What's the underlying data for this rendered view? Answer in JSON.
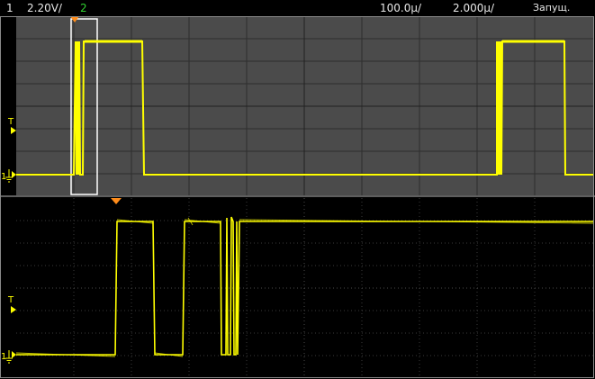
{
  "status_bar": {
    "ch1_number": "1",
    "ch1_scale": "2.20V/",
    "ch2_number": "2",
    "time_scale": "100.0µ/",
    "time_delay": "2.000µ/",
    "run_state": "Запущ."
  },
  "markers": {
    "trigger_level_label": "T",
    "ground_label": "1"
  },
  "colors": {
    "background": "#000000",
    "overview_background": "#4b4b4b",
    "grid": "#2a2a2a",
    "signal": "#ffff00",
    "trigger_marker": "#ff8c1a",
    "zoom_box": "#ffffff",
    "channel2": "#30d030",
    "text": "#e8e8e8"
  },
  "icons": {
    "trigger_marker": "triangle-down-icon",
    "level_marker": "triangle-right-icon",
    "ground_marker": "ground-icon"
  }
}
